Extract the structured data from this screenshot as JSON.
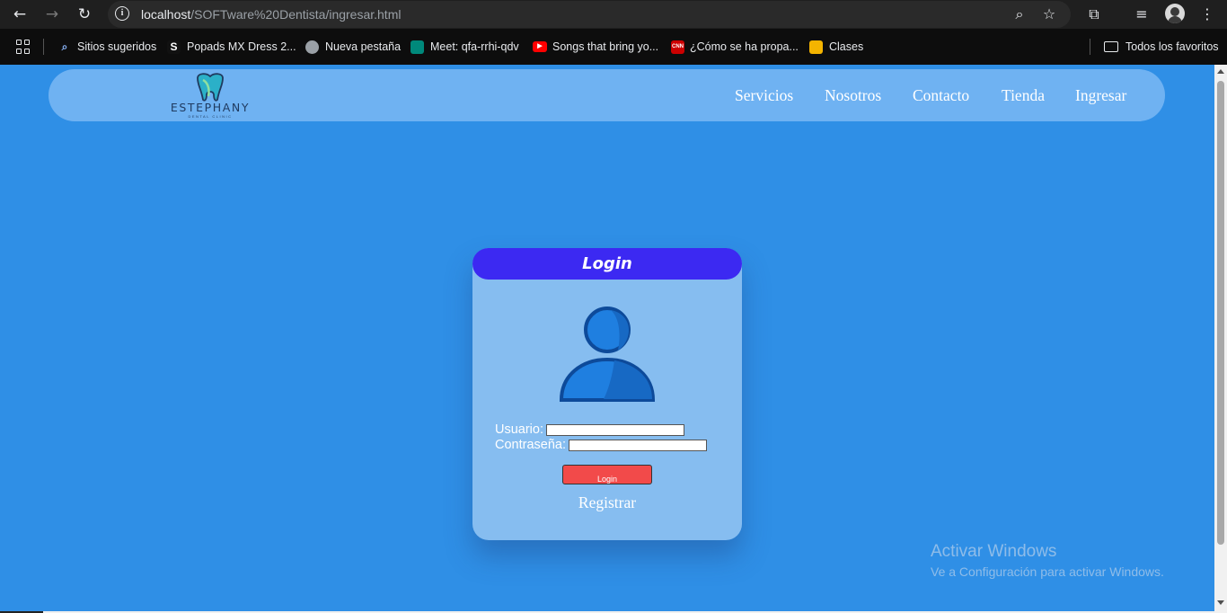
{
  "browser": {
    "url_host": "localhost",
    "url_path": "/SOFTware%20Dentista/ingresar.html",
    "bookmarks": [
      {
        "label": "Sitios sugeridos",
        "icon": "search-icon",
        "color": "#4a90e2"
      },
      {
        "label": "Popads MX Dress 2...",
        "icon": "s-logo-icon",
        "color": "#111111"
      },
      {
        "label": "Nueva pestaña",
        "icon": "globe-icon",
        "color": "#9aa0a6"
      },
      {
        "label": "Meet: qfa-rrhi-qdv",
        "icon": "meet-icon",
        "color": "#00897b"
      },
      {
        "label": "Songs that bring yo...",
        "icon": "youtube-icon",
        "color": "#ff0000"
      },
      {
        "label": "¿Cómo se ha propa...",
        "icon": "cnn-icon",
        "color": "#cc0000"
      },
      {
        "label": "Clases",
        "icon": "classroom-icon",
        "color": "#f4b400"
      }
    ],
    "all_favorites": "Todos los favoritos"
  },
  "site": {
    "logo_name": "ESTEPHANY",
    "logo_sub": "DENTAL CLINIC",
    "nav": [
      "Servicios",
      "Nosotros",
      "Contacto",
      "Tienda",
      "Ingresar"
    ]
  },
  "login": {
    "title": "Login",
    "user_label": "Usuario:",
    "user_value": "",
    "password_label": "Contraseña:",
    "password_value": "",
    "button_label": "Login",
    "register_label": "Registrar"
  },
  "watermark": {
    "title": "Activar Windows",
    "subtitle": "Ve a Configuración para activar Windows."
  },
  "colors": {
    "page_bg": "#2f8fe6",
    "navbar_bg": "#6fb2f2",
    "card_bg": "#86bdf0",
    "card_header": "#3c29f2",
    "login_button": "#f24a4a"
  }
}
